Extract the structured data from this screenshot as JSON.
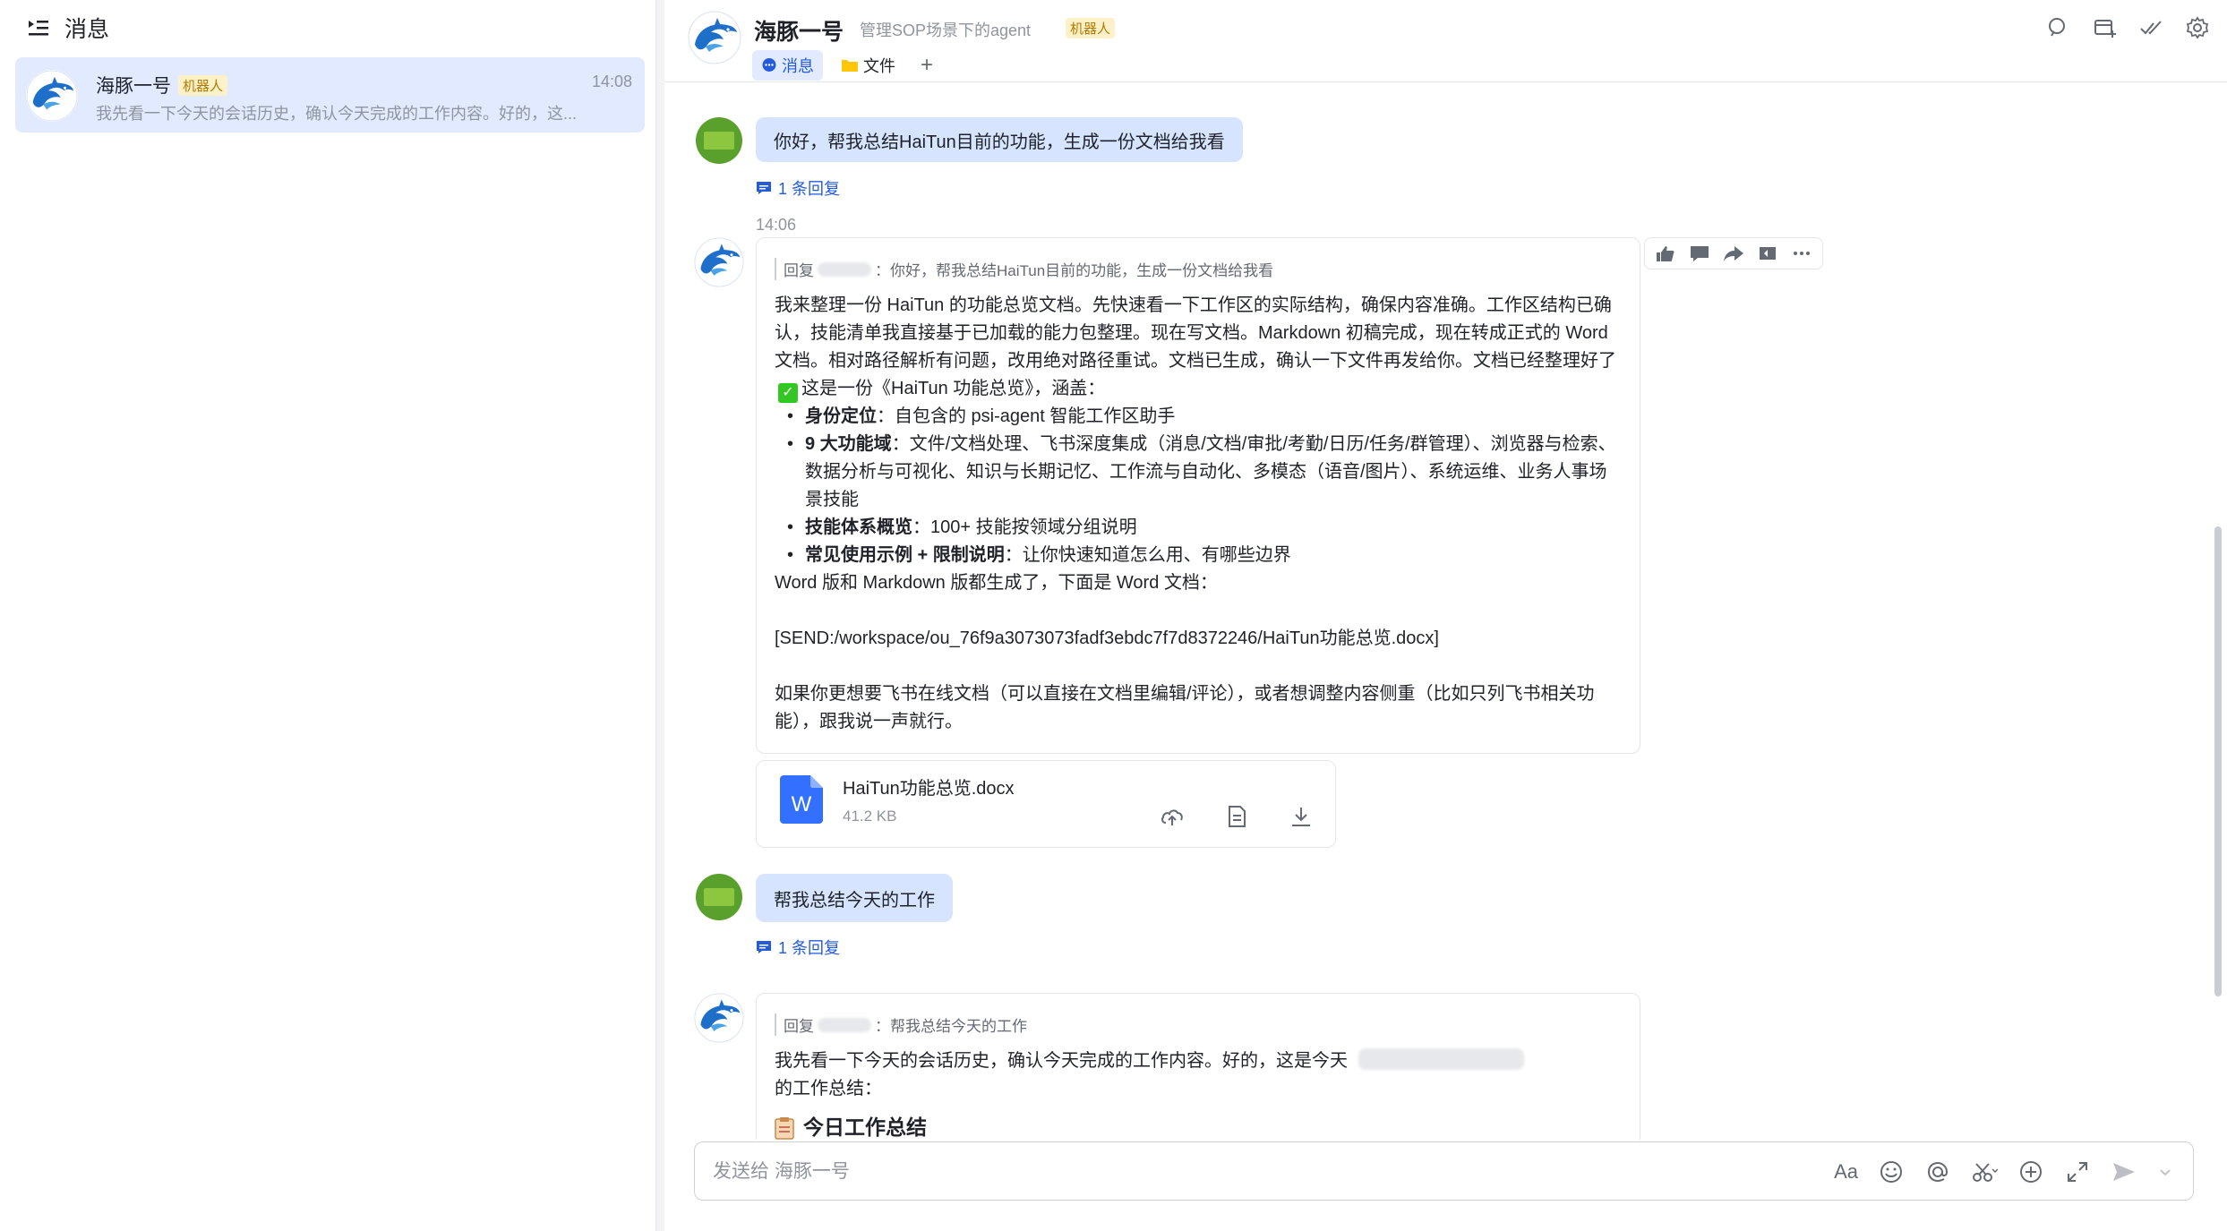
{
  "sidebar": {
    "title": "消息",
    "conversation": {
      "name": "海豚一号",
      "tag": "机器人",
      "time": "14:08",
      "preview": "我先看一下今天的会话历史，确认今天完成的工作内容。好的，这..."
    }
  },
  "header": {
    "name": "海豚一号",
    "description": "管理SOP场景下的agent",
    "tag": "机器人",
    "tabs": [
      {
        "label": "消息",
        "icon": "chat-bubble-icon"
      },
      {
        "label": "文件",
        "icon": "folder-icon"
      }
    ],
    "add_tab": "+"
  },
  "messages": {
    "m1": {
      "text": "你好，帮我总结HaiTun目前的功能，生成一份文档给我看",
      "reply_count": "1 条回复"
    },
    "time1": "14:06",
    "m2": {
      "quote_prefix": "回复",
      "quote_text": "：你好，帮我总结HaiTun目前的功能，生成一份文档给我看",
      "para1": "我来整理一份 HaiTun 的功能总览文档。先快速看一下工作区的实际结构，确保内容准确。工作区结构已确认，技能清单我直接基于已加载的能力包整理。现在写文档。Markdown 初稿完成，现在转成正式的 Word 文档。相对路径解析有问题，改用绝对路径重试。文档已生成，确认一下文件再发给你。文档已经整理好了",
      "para1_tail": "这是一份《HaiTun 功能总览》，涵盖：",
      "bullets": [
        {
          "bold": "身份定位",
          "text": "：自包含的 psi-agent 智能工作区助手"
        },
        {
          "bold": "9 大功能域",
          "text": "：文件/文档处理、飞书深度集成（消息/文档/审批/考勤/日历/任务/群管理）、浏览器与检索、数据分析与可视化、知识与长期记忆、工作流与自动化、多模态（语音/图片）、系统运维、业务人事场景技能"
        },
        {
          "bold": "技能体系概览",
          "text": "：100+ 技能按领域分组说明"
        },
        {
          "bold": "常见使用示例 + 限制说明",
          "text": "：让你快速知道怎么用、有哪些边界"
        }
      ],
      "para2": "Word 版和 Markdown 版都生成了，下面是 Word 文档：",
      "send_path": "[SEND:/workspace/ou_76f9a3073073fadf3ebdc7f7d8372246/HaiTun功能总览.docx]",
      "para3": "如果你更想要飞书在线文档（可以直接在文档里编辑/评论），或者想调整内容侧重（比如只列飞书相关功能），跟我说一声就行。"
    },
    "file": {
      "name": "HaiTun功能总览.docx",
      "size": "41.2 KB",
      "icon_letter": "W"
    },
    "m3": {
      "text": "帮我总结今天的工作",
      "reply_count": "1 条回复"
    },
    "m4": {
      "quote_prefix": "回复",
      "quote_text": "：帮我总结今天的工作",
      "para1": "我先看一下今天的会话历史，确认今天完成的工作内容。好的，这是今天",
      "para1_tail": "的工作总结：",
      "heading": "今日工作总结"
    }
  },
  "input": {
    "placeholder": "发送给 海豚一号",
    "font_label": "Aa"
  },
  "colors": {
    "accent": "#245bdb",
    "user_bubble": "#d6e4ff",
    "bot_tag_bg": "#fdf1c9",
    "bot_tag_text": "#b27c00"
  }
}
